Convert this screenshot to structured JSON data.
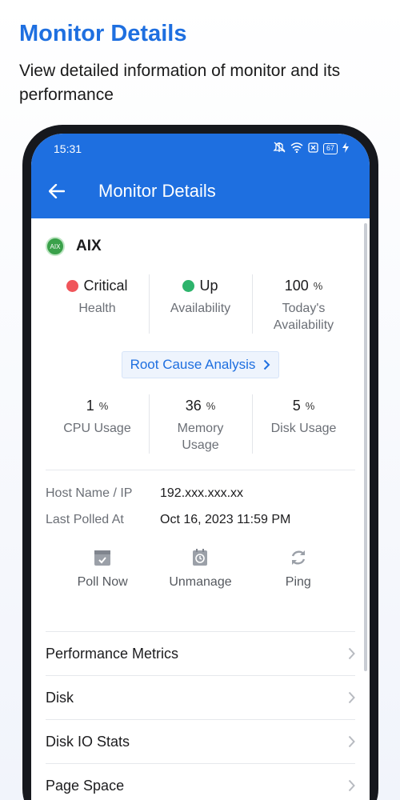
{
  "promo": {
    "title": "Monitor Details",
    "subtitle": "View detailed information of monitor and its performance"
  },
  "statusbar": {
    "time": "15:31",
    "battery": "67"
  },
  "appbar": {
    "title": "Monitor Details"
  },
  "monitor": {
    "badge": "AIX",
    "name": "AIX"
  },
  "summary": [
    {
      "value": "Critical",
      "unit": "",
      "label": "Health",
      "dot_color": "#f0555a"
    },
    {
      "value": "Up",
      "unit": "",
      "label": "Availability",
      "dot_color": "#2db46c"
    },
    {
      "value": "100",
      "unit": "%",
      "label": "Today's Availability"
    }
  ],
  "rca": {
    "label": "Root Cause Analysis"
  },
  "usage": [
    {
      "value": "1",
      "unit": "%",
      "label": "CPU Usage"
    },
    {
      "value": "36",
      "unit": "%",
      "label": "Memory Usage"
    },
    {
      "value": "5",
      "unit": "%",
      "label": "Disk Usage"
    }
  ],
  "info": [
    {
      "key": "Host Name / IP",
      "value": "192.xxx.xxx.xx"
    },
    {
      "key": "Last Polled At",
      "value": "Oct 16, 2023 11:59 PM"
    }
  ],
  "actions": [
    {
      "label": "Poll Now",
      "icon": "poll-now-icon"
    },
    {
      "label": "Unmanage",
      "icon": "unmanage-icon"
    },
    {
      "label": "Ping",
      "icon": "ping-icon"
    }
  ],
  "menu": [
    {
      "label": "Performance Metrics"
    },
    {
      "label": "Disk"
    },
    {
      "label": "Disk IO Stats"
    },
    {
      "label": "Page Space"
    }
  ],
  "colors": {
    "accent": "#1e6fe0",
    "critical": "#f0555a",
    "up": "#2db46c"
  }
}
